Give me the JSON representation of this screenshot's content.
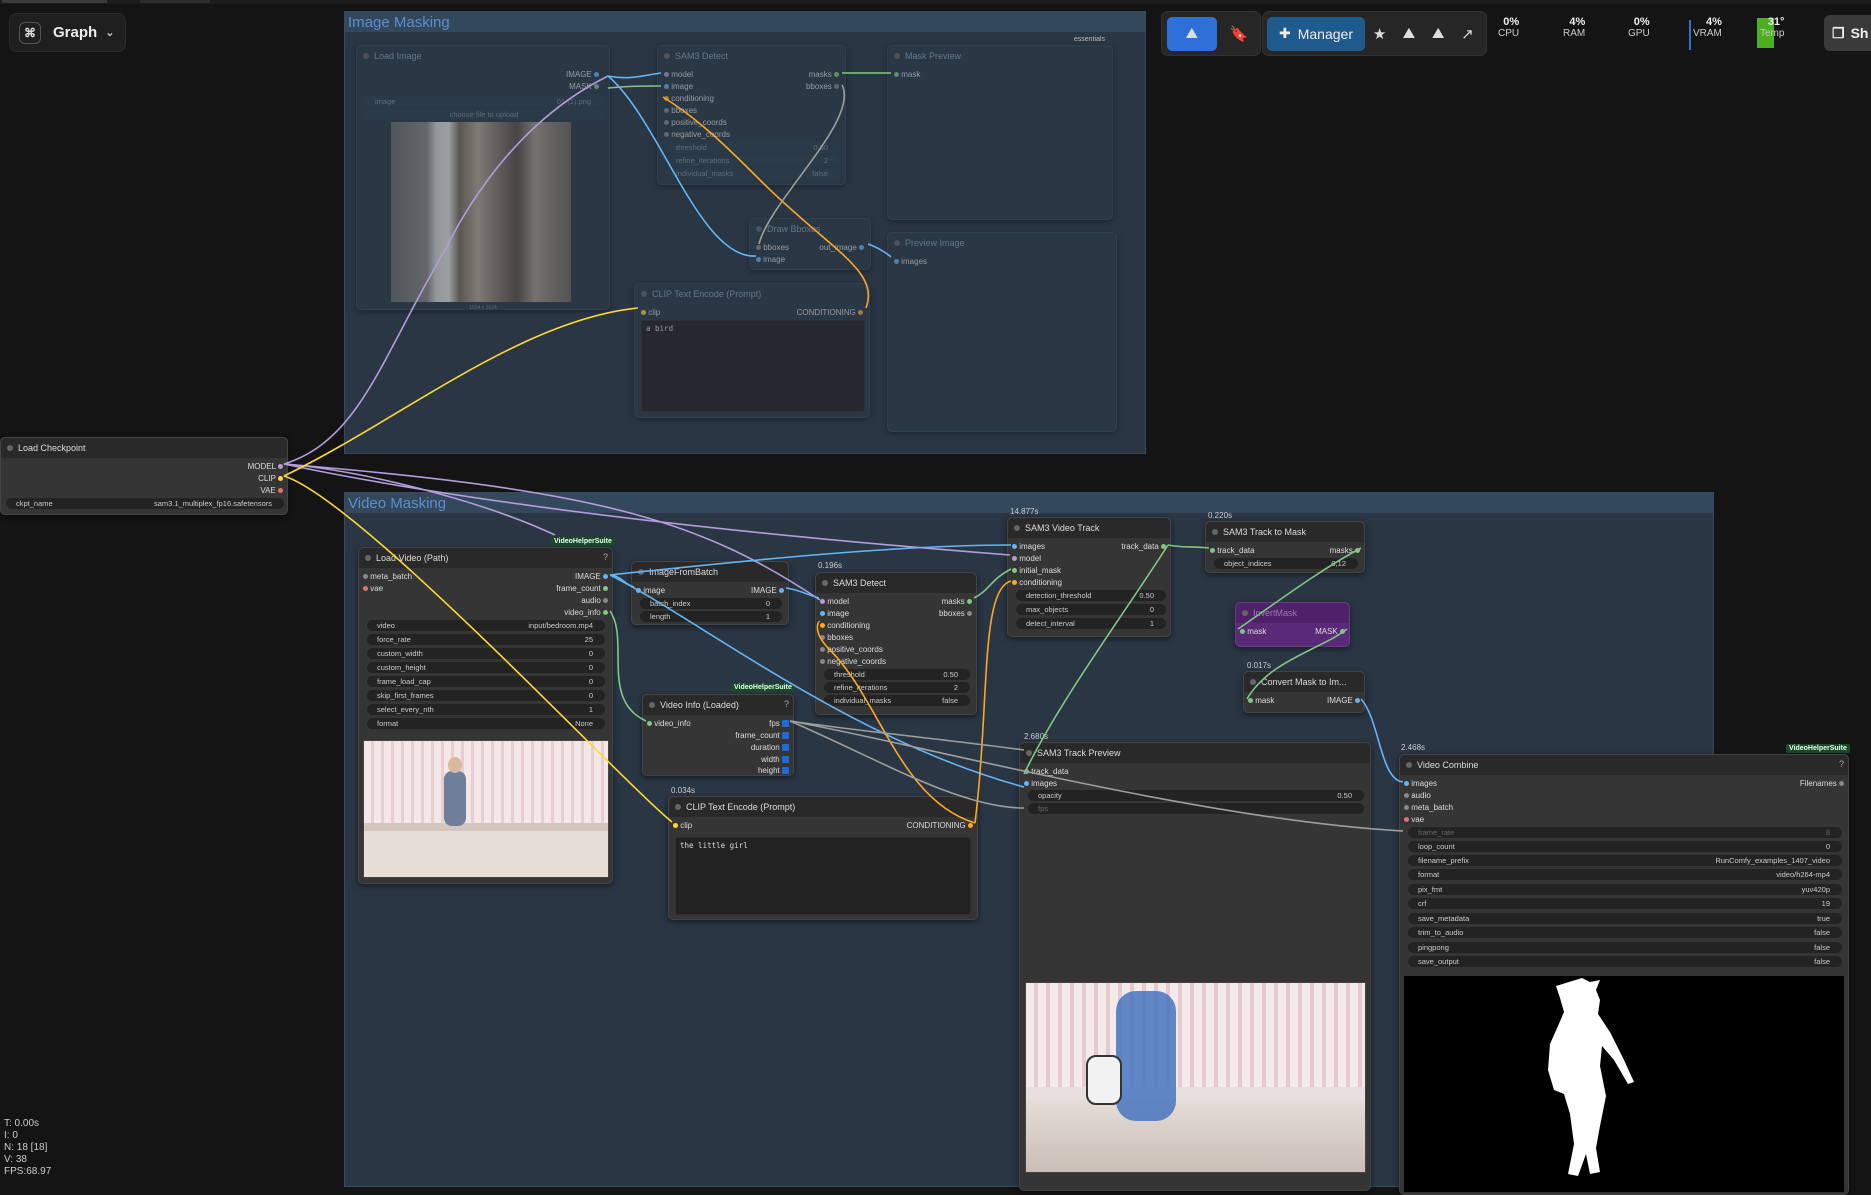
{
  "app": {
    "graph_label": "Graph"
  },
  "toolbar": {
    "manager_label": "Manager",
    "share_label": "Sh",
    "stats": [
      {
        "label": "CPU",
        "value": "0%"
      },
      {
        "label": "RAM",
        "value": "4%"
      },
      {
        "label": "GPU",
        "value": "0%"
      },
      {
        "label": "VRAM",
        "value": "4%"
      },
      {
        "label": "Temp",
        "value": "31°"
      }
    ]
  },
  "groups": {
    "image_masking": "Image Masking",
    "video_masking": "Video Masking",
    "essentials_tag": "essentials"
  },
  "load_image": {
    "title": "Load Image",
    "out_image": "IMAGE",
    "out_mask": "MASK",
    "image_label": "image",
    "image_value": "01 (1).png",
    "upload_label": "choose file to upload",
    "size_label": "1024 x 1024"
  },
  "sam3_detect_top": {
    "title": "SAM3 Detect",
    "inputs": [
      "model",
      "image",
      "conditioning",
      "bboxes",
      "positive_coords",
      "negative_coords"
    ],
    "out_masks": "masks",
    "out_bboxes": "bboxes",
    "threshold_label": "threshold",
    "threshold_value": "0.50",
    "refine_label": "refine_iterations",
    "refine_value": "2",
    "individual_label": "individual_masks",
    "individual_value": "false"
  },
  "mask_preview": {
    "title": "Mask Preview",
    "in_mask": "mask"
  },
  "draw_bboxes": {
    "title": "Draw Bboxes",
    "in_bboxes": "bboxes",
    "in_image": "image",
    "out_image": "out_image"
  },
  "preview_image": {
    "title": "Preview Image",
    "in_images": "images"
  },
  "clip_top": {
    "title": "CLIP Text Encode (Prompt)",
    "in_clip": "clip",
    "out_cond": "CONDITIONING",
    "text": "a bird"
  },
  "load_checkpoint": {
    "title": "Load Checkpoint",
    "out_model": "MODEL",
    "out_clip": "CLIP",
    "out_vae": "VAE",
    "ckpt_label": "ckpt_name",
    "ckpt_value": "sam3.1_multiplex_fp16.safetensors"
  },
  "load_video": {
    "title": "Load Video (Path)",
    "badge": "VideoHelperSuite",
    "in_meta": "meta_batch",
    "in_vae": "vae",
    "outputs": [
      "IMAGE",
      "frame_count",
      "audio",
      "video_info"
    ],
    "widgets": [
      {
        "k": "video",
        "v": "input/bedroom.mp4"
      },
      {
        "k": "force_rate",
        "v": "25"
      },
      {
        "k": "custom_width",
        "v": "0"
      },
      {
        "k": "custom_height",
        "v": "0"
      },
      {
        "k": "frame_load_cap",
        "v": "0"
      },
      {
        "k": "skip_first_frames",
        "v": "0"
      },
      {
        "k": "select_every_nth",
        "v": "1"
      },
      {
        "k": "format",
        "v": "None"
      }
    ]
  },
  "image_from_batch": {
    "title": "ImageFromBatch",
    "in_image": "image",
    "out_image": "IMAGE",
    "batch_label": "batch_index",
    "batch_value": "0",
    "length_label": "length",
    "length_value": "1"
  },
  "sam3_detect_bottom": {
    "timer": "0.196s",
    "title": "SAM3 Detect",
    "inputs": [
      "model",
      "image",
      "conditioning",
      "bboxes",
      "positive_coords",
      "negative_coords"
    ],
    "out_masks": "masks",
    "out_bboxes": "bboxes",
    "threshold_label": "threshold",
    "threshold_value": "0.50",
    "refine_label": "refine_iterations",
    "refine_value": "2",
    "individual_label": "individual_masks",
    "individual_value": "false"
  },
  "video_track": {
    "timer": "14.877s",
    "title": "SAM3 Video Track",
    "inputs": [
      "images",
      "model",
      "initial_mask",
      "conditioning"
    ],
    "out_track": "track_data",
    "widgets": [
      {
        "k": "detection_threshold",
        "v": "0.50"
      },
      {
        "k": "max_objects",
        "v": "0"
      },
      {
        "k": "detect_interval",
        "v": "1"
      }
    ]
  },
  "track_to_mask": {
    "timer": "0.220s",
    "title": "SAM3 Track to Mask",
    "in_track": "track_data",
    "out_masks": "masks",
    "indices_label": "object_indices",
    "indices_value": "0,12"
  },
  "invert_mask": {
    "title": "InvertMask",
    "in_mask": "mask",
    "out_mask": "MASK"
  },
  "convert_mask": {
    "timer": "0.017s",
    "title": "Convert Mask to Im...",
    "in_mask": "mask",
    "out_image": "IMAGE"
  },
  "video_info": {
    "title": "Video Info (Loaded)",
    "badge": "VideoHelperSuite",
    "in_info": "video_info",
    "outputs": [
      "fps",
      "frame_count",
      "duration",
      "width",
      "height"
    ]
  },
  "clip_bottom": {
    "timer": "0.034s",
    "title": "CLIP Text Encode (Prompt)",
    "in_clip": "clip",
    "out_cond": "CONDITIONING",
    "text": "the little girl"
  },
  "track_preview": {
    "timer": "2.680s",
    "title": "SAM3 Track Preview",
    "inputs": [
      "track_data",
      "images"
    ],
    "opacity_label": "opacity",
    "opacity_value": "0.50",
    "fps_label": "fps"
  },
  "video_combine": {
    "timer": "2.468s",
    "title": "Video Combine",
    "badge": "VideoHelperSuite",
    "inputs": [
      "images",
      "audio",
      "meta_batch",
      "vae"
    ],
    "out_filenames": "Filenames",
    "widgets": [
      {
        "k": "frame_rate",
        "v": "8"
      },
      {
        "k": "loop_count",
        "v": "0"
      },
      {
        "k": "filename_prefix",
        "v": "RunComfy_examples_1407_video"
      },
      {
        "k": "format",
        "v": "video/h264-mp4"
      },
      {
        "k": "pix_fmt",
        "v": "yuv420p"
      },
      {
        "k": "crf",
        "v": "19"
      },
      {
        "k": "save_metadata",
        "v": "true"
      },
      {
        "k": "trim_to_audio",
        "v": "false"
      },
      {
        "k": "pingpong",
        "v": "false"
      },
      {
        "k": "save_output",
        "v": "false"
      }
    ]
  },
  "footer": {
    "t": "T: 0.00s",
    "i": "I: 0",
    "n": "N: 18 [18]",
    "v": "V: 38",
    "fps": "FPS:68.97"
  }
}
